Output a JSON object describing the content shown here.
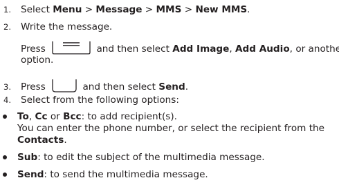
{
  "steps": [
    {
      "number": "1.",
      "prefix": "Select ",
      "menu": "Menu",
      "sep1": " > ",
      "message": "Message",
      "sep2": " > ",
      "mms": "MMS",
      "sep3": " > ",
      "new_mms": "New MMS",
      "suffix": "."
    },
    {
      "number": "2.",
      "text": "Write the message.",
      "press": "Press",
      "then_select": " and then select ",
      "add_image": "Add Image",
      "comma": ", ",
      "add_audio": "Add Audio",
      "or_another": ", or another",
      "option": "option.",
      "icon": "menu-key-icon"
    },
    {
      "number": "3.",
      "press": "Press",
      "then_select": " and then select ",
      "send": "Send",
      "suffix": ".",
      "icon": "send-key-icon"
    },
    {
      "number": "4.",
      "text": "Select from the following options:"
    }
  ],
  "bullets": [
    {
      "to": "To",
      "comma1": ", ",
      "cc": "Cc",
      "or": " or ",
      "bcc": "Bcc",
      "desc": ": to add recipient(s).",
      "line2": "You can enter the phone number, or select the recipient from the",
      "contacts": "Contacts",
      "period": "."
    },
    {
      "label": "Sub",
      "desc": ": to edit the subject of the multimedia message."
    },
    {
      "label": "Send",
      "desc": ": to send the multimedia message."
    }
  ]
}
